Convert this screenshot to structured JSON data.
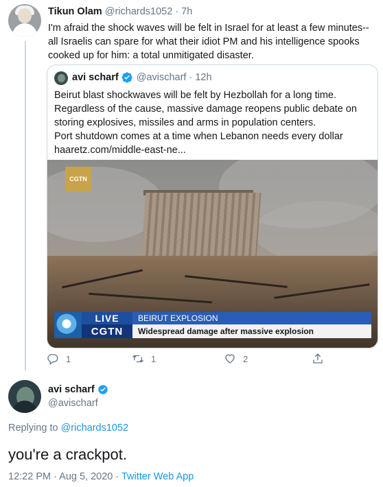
{
  "tweet1": {
    "name": "Tikun Olam",
    "handle": "@richards1052",
    "time": "· 7h",
    "text": "I'm afraid the shock waves will be felt in Israel for at least a few minutes--all Israelis can spare for what their idiot PM and his intelligence spooks cooked up for him: a total unmitigated disaster."
  },
  "quote": {
    "name": "avi scharf",
    "handle": "@avischarf",
    "time": "· 12h",
    "lines": [
      "Beirut blast shockwaves will be felt by Hezbollah for a long time.",
      "Regardless of the cause, massive damage reopens public debate on",
      "storing explosives, missiles and arms in population centers.",
      "Port shutdown comes at a time when Lebanon needs every dollar",
      "haaretz.com/middle-east-ne..."
    ],
    "media": {
      "logo": "CGTN",
      "live": "LIVE",
      "channel": "CGTN",
      "headline": "BEIRUT EXPLOSION",
      "subline": "Widespread damage after massive explosion"
    }
  },
  "actions": {
    "reply_count": "1",
    "retweet_count": "1",
    "like_count": "2"
  },
  "reply": {
    "name": "avi scharf",
    "handle": "@avischarf",
    "replying_prefix": "Replying to",
    "replying_to": "@richards1052",
    "text": "you're a crackpot.",
    "time": "12:22 PM · Aug 5, 2020 ·",
    "source": "Twitter Web App"
  },
  "icons": [
    "reply-icon",
    "retweet-icon",
    "like-icon",
    "share-icon",
    "verified-badge-icon"
  ],
  "colors": {
    "link": "#1b95e0",
    "muted": "#657786",
    "verified": "#1da1f2",
    "border": "#ccd6dd"
  }
}
